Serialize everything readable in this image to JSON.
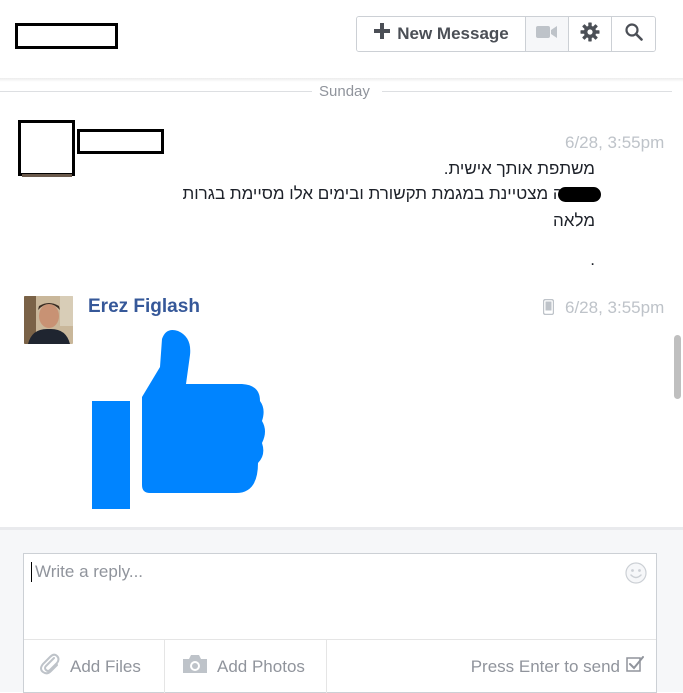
{
  "header": {
    "new_message_label": "New Message",
    "icons": [
      "plus-icon",
      "video-camera-icon",
      "gear-icon",
      "search-icon"
    ]
  },
  "conversation": {
    "day_divider": "Sunday",
    "messages": [
      {
        "time": "6/28, 3:55pm",
        "lines": [
          "משתפת אותך אישית.",
          "סיימה מצטיינת במגמת תקשורת ובימים אלו מסיימת בגרות",
          "מלאה",
          "."
        ]
      },
      {
        "sender": "Erez Figlash",
        "time": "6/28, 3:55pm",
        "sent_from": "mobile-icon",
        "content": "thumbs-up-sticker"
      }
    ]
  },
  "composer": {
    "placeholder": "Write a reply...",
    "add_files_label": "Add Files",
    "add_photos_label": "Add Photos",
    "press_enter_label": "Press Enter to send",
    "press_enter_checked": true
  },
  "colors": {
    "link_blue": "#365899",
    "like_blue": "#0084ff",
    "muted_gray": "#90949c",
    "timestamp_gray": "#bec3c9"
  }
}
